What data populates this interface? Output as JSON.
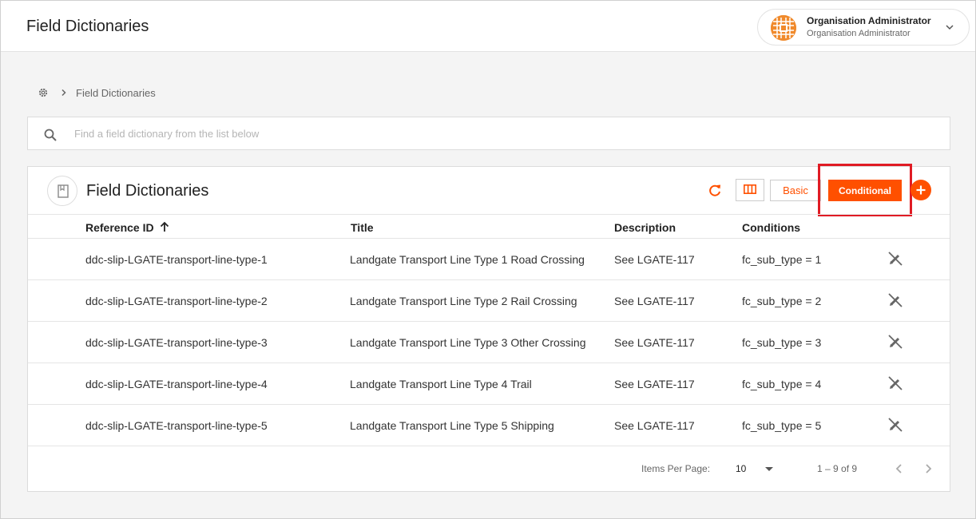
{
  "header": {
    "title": "Field Dictionaries",
    "user": {
      "name": "Organisation Administrator",
      "role": "Organisation Administrator"
    }
  },
  "breadcrumb": {
    "current": "Field Dictionaries"
  },
  "search": {
    "placeholder": "Find a field dictionary from the list below"
  },
  "panel": {
    "title": "Field Dictionaries",
    "basic_label": "Basic",
    "conditional_label": "Conditional"
  },
  "table": {
    "columns": [
      "Reference ID",
      "Title",
      "Description",
      "Conditions"
    ],
    "rows": [
      {
        "reference_id": "ddc-slip-LGATE-transport-line-type-1",
        "title": "Landgate Transport Line Type 1 Road Crossing",
        "description": "See LGATE-117",
        "conditions": "fc_sub_type = 1"
      },
      {
        "reference_id": "ddc-slip-LGATE-transport-line-type-2",
        "title": "Landgate Transport Line Type 2 Rail Crossing",
        "description": "See LGATE-117",
        "conditions": "fc_sub_type = 2"
      },
      {
        "reference_id": "ddc-slip-LGATE-transport-line-type-3",
        "title": "Landgate Transport Line Type 3 Other Crossing",
        "description": "See LGATE-117",
        "conditions": "fc_sub_type = 3"
      },
      {
        "reference_id": "ddc-slip-LGATE-transport-line-type-4",
        "title": "Landgate Transport Line Type 4 Trail",
        "description": "See LGATE-117",
        "conditions": "fc_sub_type = 4"
      },
      {
        "reference_id": "ddc-slip-LGATE-transport-line-type-5",
        "title": "Landgate Transport Line Type 5 Shipping",
        "description": "See LGATE-117",
        "conditions": "fc_sub_type = 5"
      }
    ]
  },
  "pagination": {
    "items_per_page_label": "Items Per Page:",
    "items_per_page": "10",
    "range": "1 – 9 of 9"
  },
  "colors": {
    "accent": "#ff5000",
    "highlight": "#e01b24"
  },
  "icons": {
    "breadcrumb": "gear-icon",
    "search": "search-icon",
    "refresh": "refresh-icon",
    "columns": "columns-icon",
    "add": "plus-icon",
    "row_action": "edit-off-icon"
  }
}
